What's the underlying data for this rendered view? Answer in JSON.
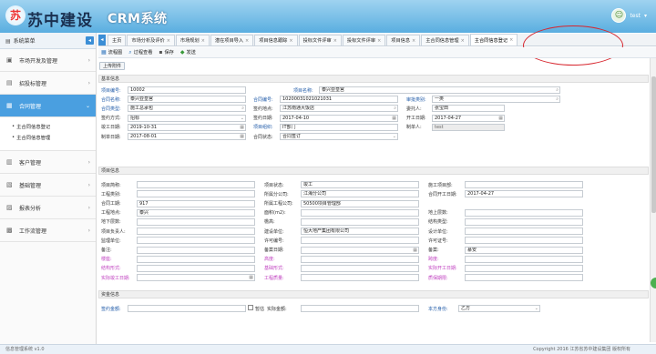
{
  "header": {
    "logo_char": "苏",
    "logo_cn": "苏中建设",
    "logo_en": "CRM系统",
    "username": "test"
  },
  "sidebar": {
    "title": "系统菜单",
    "collapse": "◂",
    "items": [
      {
        "label": "市场开发及管理",
        "icon": "▣"
      },
      {
        "label": "招投标管理",
        "icon": "▤"
      },
      {
        "label": "合同管理",
        "icon": "▦",
        "active": true
      },
      {
        "label": "客户管理",
        "icon": "▥"
      },
      {
        "label": "基础管理",
        "icon": "▧"
      },
      {
        "label": "报表分析",
        "icon": "▨"
      },
      {
        "label": "工作流管理",
        "icon": "▩"
      }
    ],
    "subitems": [
      "主合同信息登记",
      "主合同信息管理"
    ]
  },
  "tabs": [
    "主页",
    "市场分析及评价",
    "市场规划",
    "潜在项目导入",
    "项目信息跟踪",
    "投标文件评审",
    "投标文件评审",
    "项目信息",
    "主合同信息管理",
    "主合同信息登记"
  ],
  "toolbar": {
    "btn1": "流程图",
    "btn2": "过程查看",
    "btn3": "保存",
    "btn4": "发送"
  },
  "upload_label": "上传附件",
  "sections": {
    "basic": "基本信息",
    "project": "项目信息",
    "finance": "资金信息"
  },
  "basic": {
    "project_code_lbl": "项目编号:",
    "project_code": "10002",
    "project_name_lbl": "项目名称:",
    "project_name": "泰兴亚皇宫",
    "contract_name_lbl": "合同名称:",
    "contract_name": "泰兴亚皇宫",
    "contract_code_lbl": "合同编号:",
    "contract_code": "10200031021021031",
    "approval_type_lbl": "审批类别:",
    "approval_type": "一类",
    "contract_type_lbl": "合同类型:",
    "contract_type": "施工总承包",
    "sign_place_lbl": "签约地点:",
    "sign_place": "江苏南通大饭店",
    "delegate_lbl": "委托人:",
    "delegate": "张宝田",
    "sign_method_lbl": "签约方式:",
    "sign_method": "招标",
    "sign_date_lbl": "签约日期:",
    "sign_date": "2017-04-10",
    "start_date_lbl": "开工日期:",
    "start_date": "2017-04-27",
    "finish_date_lbl": "竣工日期:",
    "finish_date": "2019-10-31",
    "org_lbl": "项目组织:",
    "org": "IT部门",
    "creator_lbl": "制单人:",
    "creator": "test",
    "create_date_lbl": "制单日期:",
    "create_date": "2017-08-01",
    "contract_status_lbl": "合同状态:",
    "contract_status": "合同签订"
  },
  "project": {
    "abbr_lbl": "项目简称:",
    "status_lbl": "项目状态:",
    "status": "竣工",
    "proj_date_lbl": "施工项目部:",
    "proj_type_lbl": "工程类别:",
    "branch_lbl": "所属分公司:",
    "branch": "江海分公司",
    "contract_start_lbl": "合同开工日期:",
    "contract_start": "2017-04-27",
    "period_lbl": "合同工期:",
    "period": "917",
    "dept_lbl": "所属工程公司:",
    "dept": "50500项目管理部",
    "location_lbl": "工程地点:",
    "location": "泰兴",
    "area_lbl": "面积(m2):",
    "above_lbl": "地上层数:",
    "below_lbl": "地下层数:",
    "height_lbl": "檐高:",
    "struct_lbl": "结构类型:",
    "manager_lbl": "项目负责人:",
    "builder_lbl": "建设单位:",
    "builder": "恒大地产集团有限公司",
    "design_lbl": "设计单位:",
    "supervise_lbl": "监理单位:",
    "license_lbl": "许可编号:",
    "permit_lbl": "许可证号:",
    "remark_lbl": "备注:",
    "record_date_lbl": "备案日期:",
    "record_person_lbl": "备案:",
    "record_person": "慕安",
    "r1": "楼座:",
    "r2": "高度:",
    "r3": "跨度:",
    "r4": "结构形式:",
    "r5": "基础形式:",
    "r6": "实际开工日期:",
    "r7": "实际竣工日期:",
    "r8": "工程质量:",
    "r9": "质保期限:"
  },
  "finance": {
    "amount_lbl": "签约金额:",
    "tax_lbl": "暂估",
    "real_lbl": "实际金额:",
    "party_lbl": "本方身份:",
    "party": "乙方"
  },
  "footer": {
    "left": "信息管理系统 v1.0",
    "right": "Copyright 2016  江苏省苏中建设集团 版权所有"
  }
}
